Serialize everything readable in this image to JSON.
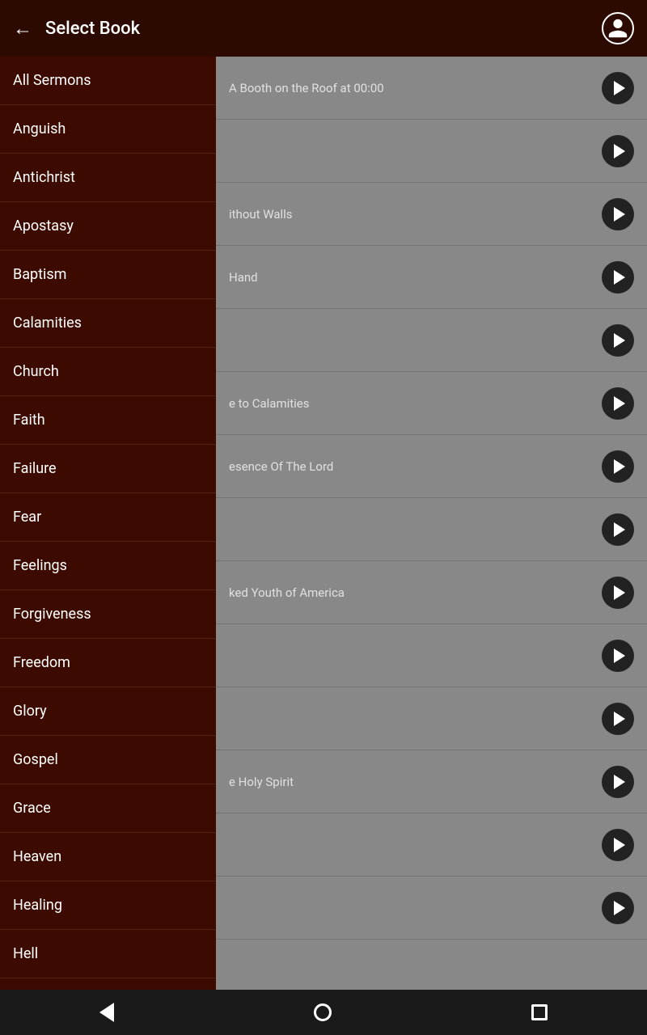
{
  "appBar": {
    "title": "Select Book",
    "backLabel": "←",
    "avatarIcon": "account-circle-icon"
  },
  "sidebar": {
    "items": [
      {
        "id": "all-sermons",
        "label": "All Sermons"
      },
      {
        "id": "anguish",
        "label": "Anguish"
      },
      {
        "id": "antichrist",
        "label": "Antichrist"
      },
      {
        "id": "apostasy",
        "label": "Apostasy"
      },
      {
        "id": "baptism",
        "label": "Baptism"
      },
      {
        "id": "calamities",
        "label": "Calamities"
      },
      {
        "id": "church",
        "label": "Church"
      },
      {
        "id": "faith",
        "label": "Faith"
      },
      {
        "id": "failure",
        "label": "Failure"
      },
      {
        "id": "fear",
        "label": "Fear"
      },
      {
        "id": "feelings",
        "label": "Feelings"
      },
      {
        "id": "forgiveness",
        "label": "Forgiveness"
      },
      {
        "id": "freedom",
        "label": "Freedom"
      },
      {
        "id": "glory",
        "label": "Glory"
      },
      {
        "id": "gospel",
        "label": "Gospel"
      },
      {
        "id": "grace",
        "label": "Grace"
      },
      {
        "id": "heaven",
        "label": "Heaven"
      },
      {
        "id": "healing",
        "label": "Healing"
      },
      {
        "id": "hell",
        "label": "Hell"
      }
    ]
  },
  "sermons": {
    "items": [
      {
        "id": 1,
        "title": "A Booth on the Roof at 00:00"
      },
      {
        "id": 2,
        "title": ""
      },
      {
        "id": 3,
        "title": "ithout Walls"
      },
      {
        "id": 4,
        "title": "Hand"
      },
      {
        "id": 5,
        "title": ""
      },
      {
        "id": 6,
        "title": "e to Calamities"
      },
      {
        "id": 7,
        "title": "esence Of The Lord"
      },
      {
        "id": 8,
        "title": ""
      },
      {
        "id": 9,
        "title": "ked Youth of America"
      },
      {
        "id": 10,
        "title": ""
      },
      {
        "id": 11,
        "title": ""
      },
      {
        "id": 12,
        "title": "e Holy Spirit"
      },
      {
        "id": 13,
        "title": ""
      },
      {
        "id": 14,
        "title": ""
      }
    ]
  },
  "bottomNav": {
    "backLabel": "back",
    "homeLabel": "home",
    "recentLabel": "recent"
  }
}
